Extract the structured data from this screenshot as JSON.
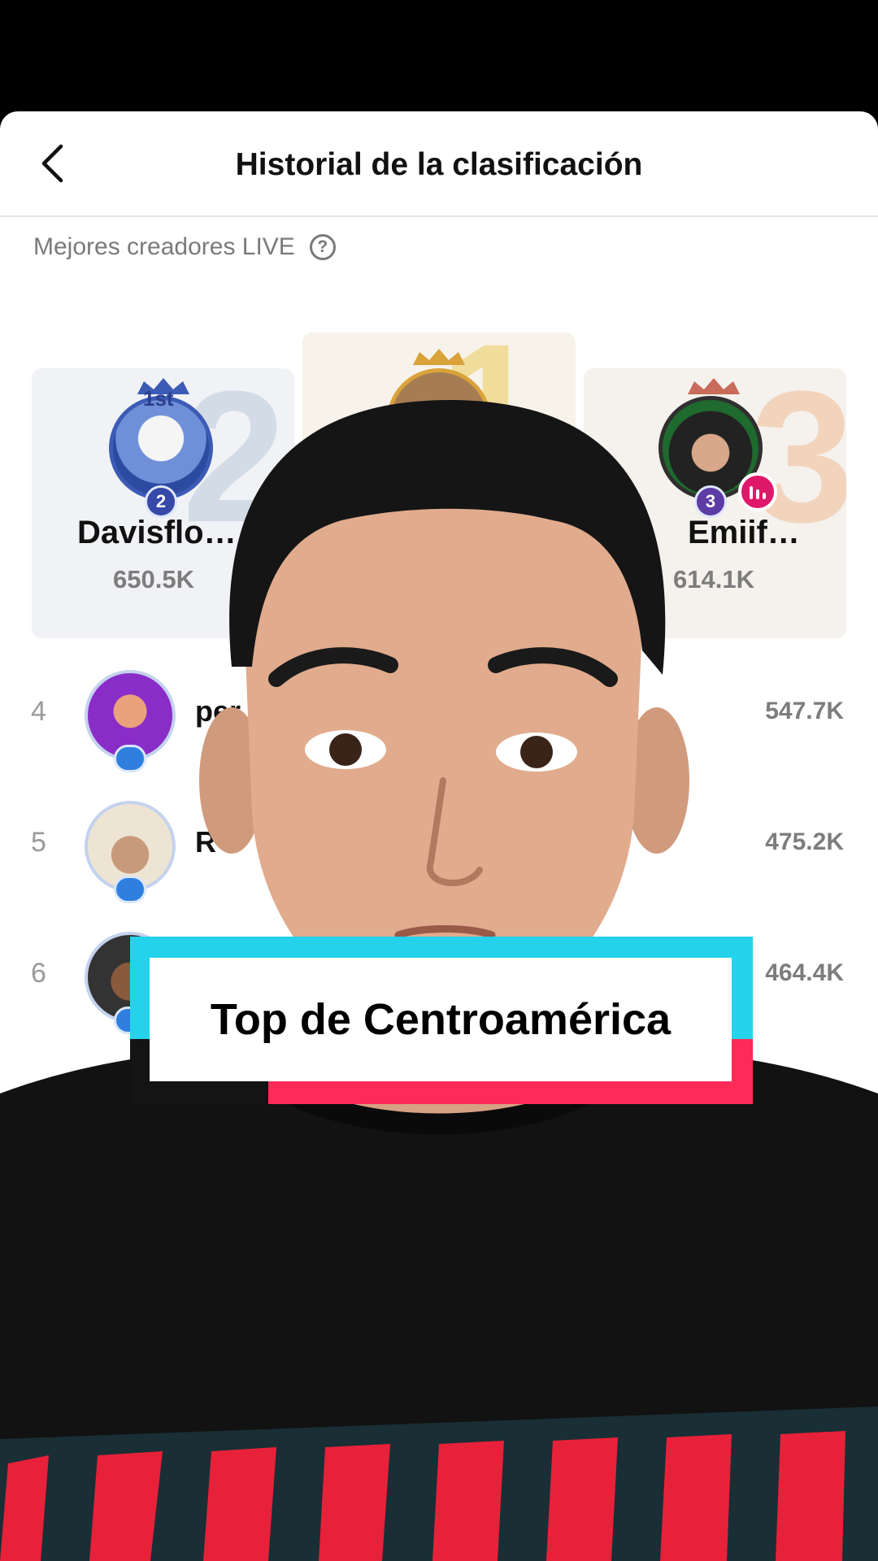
{
  "header": {
    "title": "Historial de la clasificación",
    "back_icon": "chevron-left-icon"
  },
  "section": {
    "label": "Mejores creadores LIVE",
    "help_icon": "question-circle-icon",
    "help_glyph": "?"
  },
  "podium": [
    {
      "rank": "2",
      "badge": "1st",
      "name": "Davisflo…",
      "score": "650.5K",
      "big_number": "2"
    },
    {
      "rank": "1",
      "badge": "",
      "name": "",
      "score": "",
      "big_number": "1"
    },
    {
      "rank": "3",
      "badge": "",
      "name": "Emiif…",
      "score": "614.1K",
      "big_number": "3",
      "live": true
    }
  ],
  "list": [
    {
      "rank": "4",
      "name": "per",
      "score": "547.7K"
    },
    {
      "rank": "5",
      "name": "R",
      "score": "475.2K"
    },
    {
      "rank": "6",
      "name": "",
      "score": "464.4K"
    }
  ],
  "caption": {
    "text": "Top de Centroamérica"
  },
  "colors": {
    "caption_cyan": "#25d2ec",
    "caption_red": "#fe2a58",
    "rank_badge": "#3648a8",
    "live_badge": "#e0186a"
  }
}
